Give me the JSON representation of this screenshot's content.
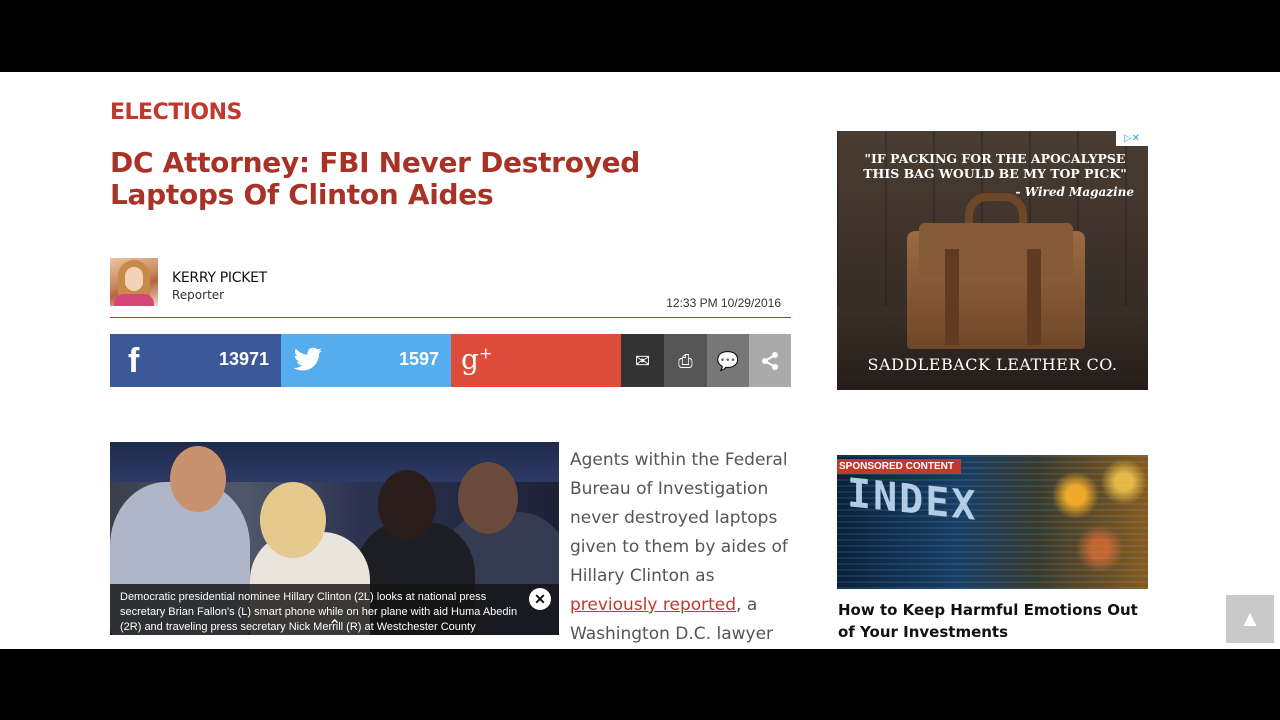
{
  "article": {
    "section": "ELECTIONS",
    "headline": "DC Attorney: FBI Never Destroyed Laptops Of Clinton Aides",
    "author": {
      "name": "KERRY PICKET",
      "role": "Reporter"
    },
    "timestamp": "12:33 PM 10/29/2016",
    "body_before_link": "Agents within the Federal Bureau of Investigation never destroyed laptops given to them by aides of Hillary Clinton as",
    "body_link": "previously reported",
    "body_after_link": ", a Washington D.C. lawyer",
    "image_caption": "Democratic presidential nominee Hillary Clinton (2L) looks at national press secretary Brian Fallon's (L) smart phone while on her plane with aid Huma Abedin (2R) and traveling press secretary Nick Merrill (R) at Westchester County"
  },
  "share": {
    "facebook_count": "13971",
    "twitter_count": "1597",
    "colors": {
      "facebook": "#3b5998",
      "twitter": "#55acee",
      "google_plus": "#dd4b39"
    }
  },
  "ad": {
    "quote": "\"IF PACKING FOR THE APOCALYPSE THIS BAG WOULD BE MY TOP PICK\"",
    "source": "- Wired Magazine",
    "brand": "SADDLEBACK LEATHER CO."
  },
  "sponsored": {
    "tag": "SPONSORED CONTENT",
    "image_text": "INDEX",
    "title": "How to Keep Harmful Emotions Out of Your Investments"
  },
  "back_to_top": "▲"
}
